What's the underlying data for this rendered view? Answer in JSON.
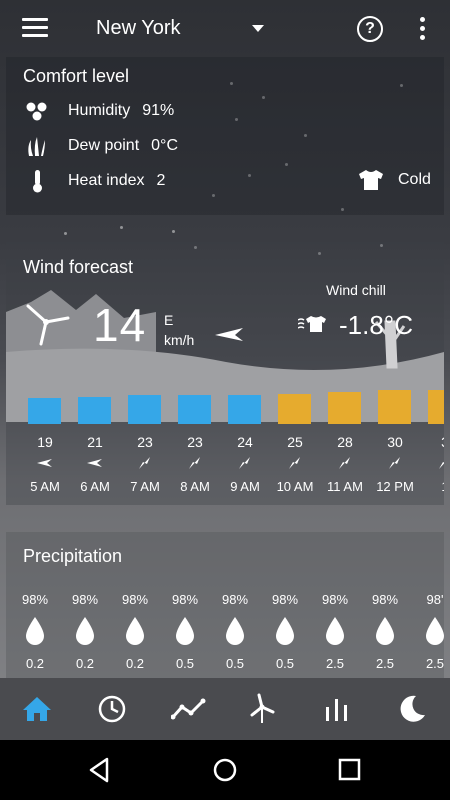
{
  "header": {
    "city": "New York",
    "menu_icon": "hamburger-menu-icon",
    "help_icon": "help-circle-icon",
    "more_icon": "more-vert-icon"
  },
  "comfort": {
    "title": "Comfort level",
    "humidity": {
      "label": "Humidity",
      "value": "91%"
    },
    "dew_point": {
      "label": "Dew point",
      "value": "0°C"
    },
    "heat_index": {
      "label": "Heat index",
      "value": "2"
    },
    "feel": "Cold"
  },
  "wind": {
    "title": "Wind forecast",
    "speed": "14",
    "direction": "E",
    "unit": "km/h",
    "chill_label": "Wind chill",
    "chill_value": "-1.8°C",
    "hours": [
      {
        "value": "19",
        "time": "5 AM",
        "color": "#35a7e8",
        "level": 19
      },
      {
        "value": "21",
        "time": "6 AM",
        "color": "#35a7e8",
        "level": 21
      },
      {
        "value": "23",
        "time": "7 AM",
        "color": "#35a7e8",
        "level": 23
      },
      {
        "value": "23",
        "time": "8 AM",
        "color": "#35a7e8",
        "level": 23
      },
      {
        "value": "24",
        "time": "9 AM",
        "color": "#35a7e8",
        "level": 24
      },
      {
        "value": "25",
        "time": "10 AM",
        "color": "#e6ab2e",
        "level": 25
      },
      {
        "value": "28",
        "time": "11 AM",
        "color": "#e6ab2e",
        "level": 28
      },
      {
        "value": "30",
        "time": "12 PM",
        "color": "#e6ab2e",
        "level": 30
      },
      {
        "value": "3",
        "time": "1",
        "color": "#e6ab2e",
        "level": 30
      }
    ]
  },
  "precipitation": {
    "title": "Precipitation",
    "hours": [
      {
        "prob": "98%",
        "amount": "0.2"
      },
      {
        "prob": "98%",
        "amount": "0.2"
      },
      {
        "prob": "98%",
        "amount": "0.2"
      },
      {
        "prob": "98%",
        "amount": "0.5"
      },
      {
        "prob": "98%",
        "amount": "0.5"
      },
      {
        "prob": "98%",
        "amount": "0.5"
      },
      {
        "prob": "98%",
        "amount": "2.5"
      },
      {
        "prob": "98%",
        "amount": "2.5"
      },
      {
        "prob": "98'",
        "amount": "2.5"
      }
    ]
  },
  "bottom_nav": [
    {
      "name": "home",
      "icon": "home-icon",
      "active": true
    },
    {
      "name": "hourly",
      "icon": "clock-icon",
      "active": false
    },
    {
      "name": "graph",
      "icon": "trend-line-icon",
      "active": false
    },
    {
      "name": "wind",
      "icon": "wind-turbine-icon",
      "active": false
    },
    {
      "name": "bars",
      "icon": "bar-chart-icon",
      "active": false
    },
    {
      "name": "moon",
      "icon": "moon-icon",
      "active": false
    }
  ],
  "colors": {
    "accent": "#35a7e8",
    "warm": "#e6ab2e",
    "nav_bg": "#4a4b4f"
  }
}
